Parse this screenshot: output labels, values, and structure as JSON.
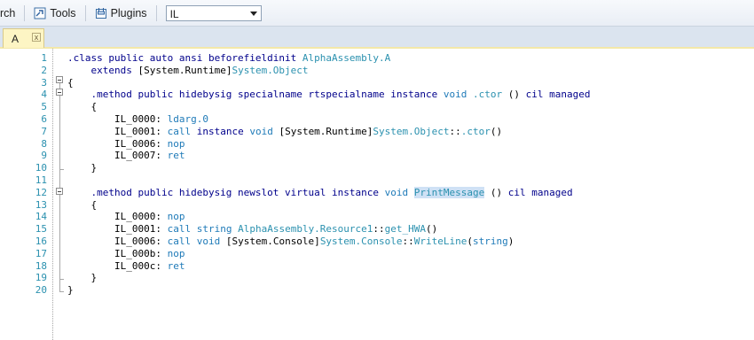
{
  "toolbar": {
    "search_label": "rch",
    "tools_label": "Tools",
    "plugins_label": "Plugins",
    "language_value": "IL"
  },
  "tab": {
    "label": "A",
    "close_glyph": "x"
  },
  "colors": {
    "keyword": "#00008b",
    "type": "#2b91af",
    "opcode": "#1e7ab8",
    "line_number": "#2b91af",
    "selection": "#cfe1f5",
    "tab_active": "#fdf5c4"
  },
  "code_lines": [
    {
      "n": "1",
      "parts": [
        {
          "t": ".class public auto ansi beforefieldinit ",
          "c": "kw"
        },
        {
          "t": "AlphaAssembly.A",
          "c": "ty"
        }
      ]
    },
    {
      "n": "2",
      "parts": [
        {
          "t": "    extends ",
          "c": "kw"
        },
        {
          "t": "[System.Runtime]",
          "c": ""
        },
        {
          "t": "System.Object",
          "c": "ty"
        }
      ]
    },
    {
      "n": "3",
      "parts": [
        {
          "t": "{",
          "c": ""
        }
      ]
    },
    {
      "n": "4",
      "parts": [
        {
          "t": "    .method public hidebysig specialname rtspecialname instance ",
          "c": "kw"
        },
        {
          "t": "void",
          "c": "op"
        },
        {
          "t": " ",
          "c": ""
        },
        {
          "t": ".ctor",
          "c": "ty"
        },
        {
          "t": " () ",
          "c": ""
        },
        {
          "t": "cil managed",
          "c": "kw"
        }
      ]
    },
    {
      "n": "5",
      "parts": [
        {
          "t": "    {",
          "c": ""
        }
      ]
    },
    {
      "n": "6",
      "parts": [
        {
          "t": "        IL_0000: ",
          "c": ""
        },
        {
          "t": "ldarg.0",
          "c": "op"
        }
      ]
    },
    {
      "n": "7",
      "parts": [
        {
          "t": "        IL_0001: ",
          "c": ""
        },
        {
          "t": "call",
          "c": "op"
        },
        {
          "t": " instance ",
          "c": "kw"
        },
        {
          "t": "void",
          "c": "op"
        },
        {
          "t": " [System.Runtime]",
          "c": ""
        },
        {
          "t": "System.Object",
          "c": "ty"
        },
        {
          "t": "::",
          "c": ""
        },
        {
          "t": ".ctor",
          "c": "ty"
        },
        {
          "t": "()",
          "c": ""
        }
      ]
    },
    {
      "n": "8",
      "parts": [
        {
          "t": "        IL_0006: ",
          "c": ""
        },
        {
          "t": "nop",
          "c": "op"
        }
      ]
    },
    {
      "n": "9",
      "parts": [
        {
          "t": "        IL_0007: ",
          "c": ""
        },
        {
          "t": "ret",
          "c": "op"
        }
      ]
    },
    {
      "n": "10",
      "parts": [
        {
          "t": "    }",
          "c": ""
        }
      ]
    },
    {
      "n": "11",
      "parts": []
    },
    {
      "n": "12",
      "parts": [
        {
          "t": "    .method public hidebysig newslot virtual instance ",
          "c": "kw"
        },
        {
          "t": "void",
          "c": "op"
        },
        {
          "t": " ",
          "c": ""
        },
        {
          "t": "PrintMessage",
          "c": "ty hl"
        },
        {
          "t": " () ",
          "c": ""
        },
        {
          "t": "cil managed",
          "c": "kw"
        }
      ]
    },
    {
      "n": "13",
      "parts": [
        {
          "t": "    {",
          "c": ""
        }
      ]
    },
    {
      "n": "14",
      "parts": [
        {
          "t": "        IL_0000: ",
          "c": ""
        },
        {
          "t": "nop",
          "c": "op"
        }
      ]
    },
    {
      "n": "15",
      "parts": [
        {
          "t": "        IL_0001: ",
          "c": ""
        },
        {
          "t": "call",
          "c": "op"
        },
        {
          "t": " ",
          "c": ""
        },
        {
          "t": "string",
          "c": "op"
        },
        {
          "t": " ",
          "c": ""
        },
        {
          "t": "AlphaAssembly.Resource1",
          "c": "ty"
        },
        {
          "t": "::",
          "c": ""
        },
        {
          "t": "get_HWA",
          "c": "ty"
        },
        {
          "t": "()",
          "c": ""
        }
      ]
    },
    {
      "n": "16",
      "parts": [
        {
          "t": "        IL_0006: ",
          "c": ""
        },
        {
          "t": "call",
          "c": "op"
        },
        {
          "t": " ",
          "c": ""
        },
        {
          "t": "void",
          "c": "op"
        },
        {
          "t": " [System.Console]",
          "c": ""
        },
        {
          "t": "System.Console",
          "c": "ty"
        },
        {
          "t": "::",
          "c": ""
        },
        {
          "t": "WriteLine",
          "c": "ty"
        },
        {
          "t": "(",
          "c": ""
        },
        {
          "t": "string",
          "c": "op"
        },
        {
          "t": ")",
          "c": ""
        }
      ]
    },
    {
      "n": "17",
      "parts": [
        {
          "t": "        IL_000b: ",
          "c": ""
        },
        {
          "t": "nop",
          "c": "op"
        }
      ]
    },
    {
      "n": "18",
      "parts": [
        {
          "t": "        IL_000c: ",
          "c": ""
        },
        {
          "t": "ret",
          "c": "op"
        }
      ]
    },
    {
      "n": "19",
      "parts": [
        {
          "t": "    }",
          "c": ""
        }
      ]
    },
    {
      "n": "20",
      "parts": [
        {
          "t": "}",
          "c": ""
        }
      ]
    }
  ]
}
